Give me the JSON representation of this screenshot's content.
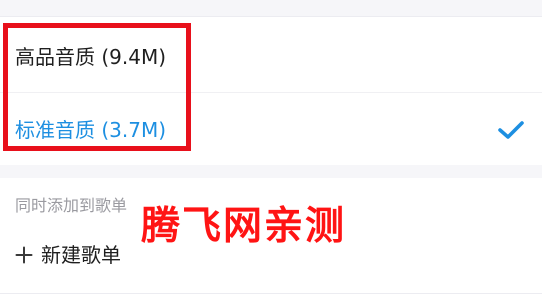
{
  "quality_options": {
    "high": {
      "label": "高品音质 (9.4M)",
      "selected": false
    },
    "standard": {
      "label": "标准音质 (3.7M)",
      "selected": true,
      "check_icon": "checkmark-icon"
    }
  },
  "playlist_section": {
    "title": "同时添加到歌单",
    "new_playlist_label": "新建歌单",
    "new_playlist_icon": "plus-icon"
  },
  "watermark": {
    "text": "腾飞网亲测"
  },
  "colors": {
    "accent": "#1d8fe1",
    "highlight_border": "#e8101b",
    "watermark": "#ff1414",
    "section_title": "#9a9aa0"
  }
}
